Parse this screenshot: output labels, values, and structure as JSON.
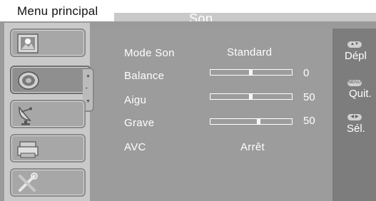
{
  "header": {
    "menu_title": "Menu principal",
    "page_title": "Son"
  },
  "sidebar": {
    "items": [
      {
        "icon": "picture-icon",
        "active": false
      },
      {
        "icon": "speaker-icon",
        "active": true
      },
      {
        "icon": "satellite-dish-icon",
        "active": false
      },
      {
        "icon": "keyboard-icon",
        "active": false
      },
      {
        "icon": "tools-icon",
        "active": false
      }
    ],
    "scroll": {
      "up": "▲",
      "mid": "•",
      "down": "▼"
    }
  },
  "settings": {
    "mode": {
      "label": "Mode Son",
      "value": "Standard"
    },
    "balance": {
      "label": "Balance",
      "value": "0",
      "level": 0.5
    },
    "treble": {
      "label": "Aigu",
      "value": "50",
      "level": 0.5
    },
    "bass": {
      "label": "Grave",
      "value": "50",
      "level": 0.6
    },
    "avc": {
      "label": "AVC",
      "value": "Arrêt"
    }
  },
  "help": {
    "move": {
      "key": "▲▼",
      "label": "Dépl"
    },
    "quit": {
      "key": "MENU",
      "label": "Quit."
    },
    "select": {
      "key": "◀ ▶",
      "label": "Sél."
    }
  },
  "colors": {
    "panel": "#9c9c9c",
    "sidebar": "#c9c9c9",
    "help_panel": "#7d7d7d",
    "text": "#ffffff"
  }
}
